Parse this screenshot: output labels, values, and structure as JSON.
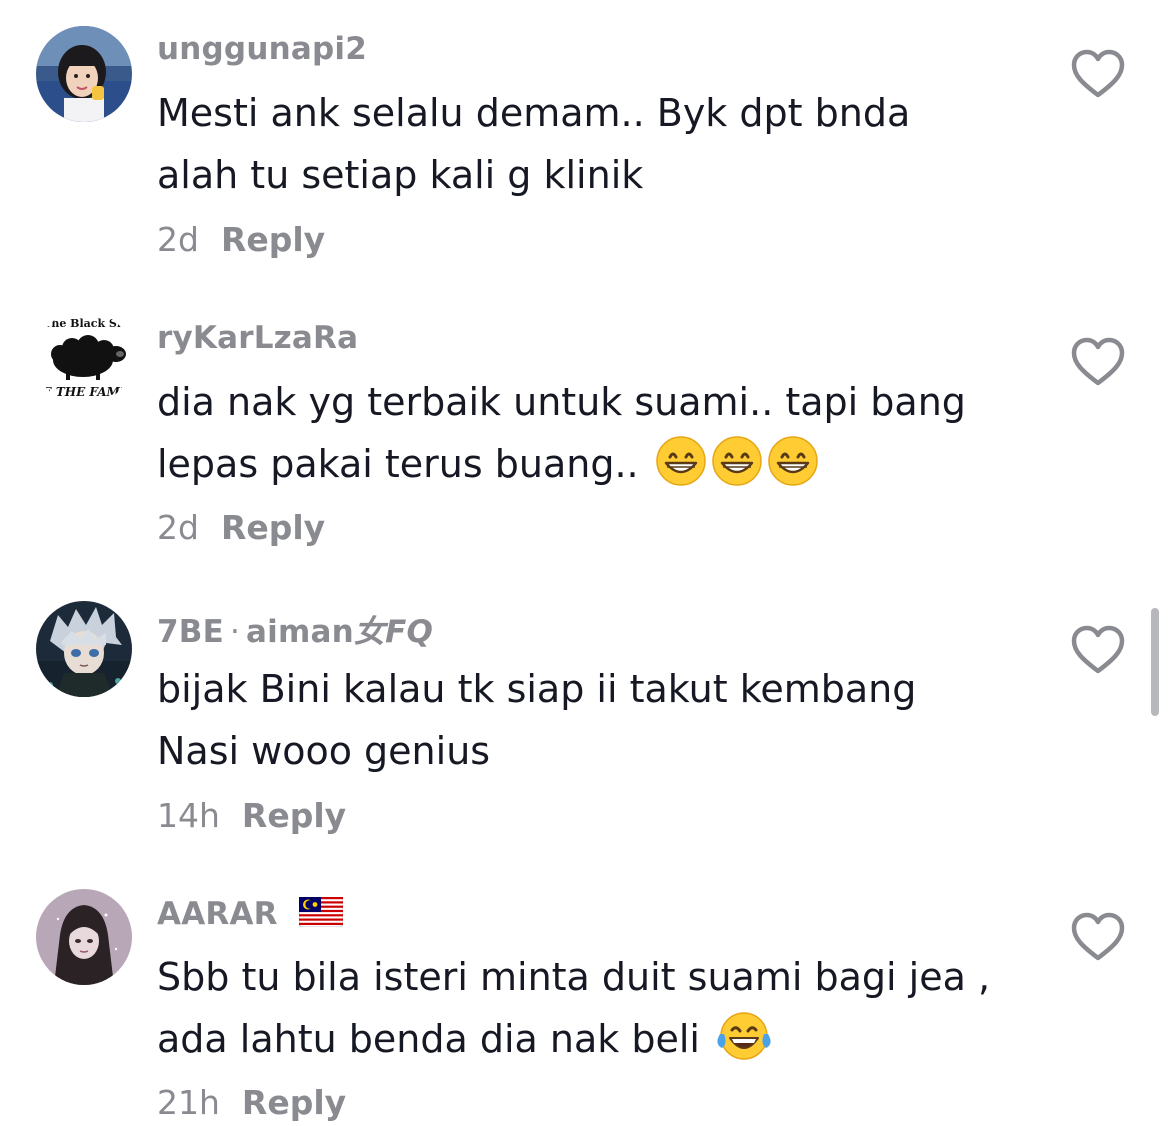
{
  "comments": [
    {
      "username": "unggunapi2",
      "lines": [
        "Mesti ank selalu demam.. Byk dpt bnda",
        "alah tu setiap kali g klinik"
      ],
      "time": "2d",
      "reply_label": "Reply",
      "avatar_icon": "girl-photo-avatar"
    },
    {
      "username": "ryKarLzaRa",
      "lines": [
        "dia nak yg terbaik untuk suami.. tapi bang",
        "lepas pakai terus buang.."
      ],
      "emoji": [
        "grinning-face-emoji",
        "grinning-face-emoji",
        "grinning-face-emoji"
      ],
      "time": "2d",
      "reply_label": "Reply",
      "avatar_icon": "black-sheep-logo-avatar",
      "avatar_text_top": "The Black Sh",
      "avatar_text_bottom": "E THE FAMI"
    },
    {
      "username": "7BE",
      "separator": "·",
      "nickname_a": "aiman",
      "nickname_b": "女FQ",
      "lines": [
        "bijak Bini kalau tk siap ii takut kembang",
        "Nasi wooo genius"
      ],
      "time": "14h",
      "reply_label": "Reply",
      "avatar_icon": "anime-character-avatar"
    },
    {
      "username": "AARAR",
      "flag_icon": "malaysia-flag-icon",
      "lines": [
        "Sbb tu bila isteri minta duit suami bagi jea ,",
        "ada lahtu benda dia nak beli"
      ],
      "emoji": [
        "tears-of-joy-emoji"
      ],
      "time": "21h",
      "reply_label": "Reply",
      "avatar_icon": "hooded-girl-drawing-avatar"
    }
  ],
  "colors": {
    "secondary_text": "#8a8b91",
    "primary_text": "#161823",
    "icon_stroke": "#8a8b91"
  },
  "icons": {
    "like": "heart-outline-icon"
  }
}
